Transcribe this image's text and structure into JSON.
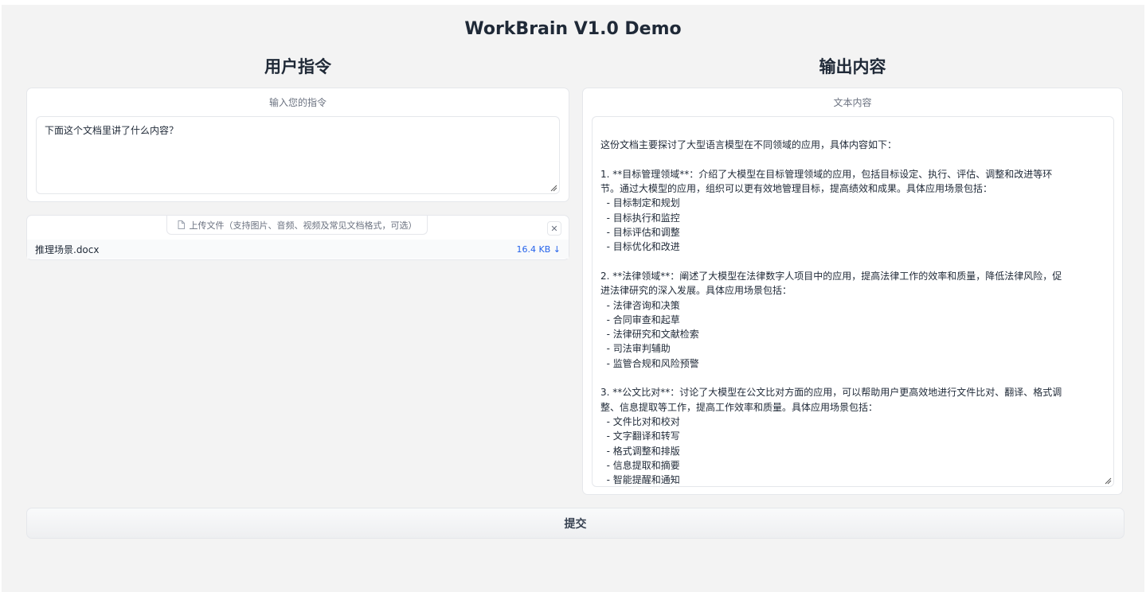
{
  "app_title": "WorkBrain V1.0 Demo",
  "left": {
    "title": "用户指令",
    "instruction_label": "输入您的指令",
    "instruction_value": "下面这个文档里讲了什么内容？",
    "upload_label": "上传文件（支持图片、音频、视频及常见文档格式，可选）",
    "clear_icon": "close-icon",
    "file": {
      "name": "推理场景.docx",
      "size": "16.4 KB ↓"
    }
  },
  "right": {
    "title": "输出内容",
    "output_label": "文本内容",
    "output_lines": [
      "",
      "这份文档主要探讨了大型语言模型在不同领域的应用，具体内容如下：",
      "",
      "1. **目标管理领域**：介绍了大模型在目标管理领域的应用，包括目标设定、执行、评估、调整和改进等环",
      "节。通过大模型的应用，组织可以更有效地管理目标，提高绩效和成果。具体应用场景包括：",
      "  - 目标制定和规划",
      "  - 目标执行和监控",
      "  - 目标评估和调整",
      "  - 目标优化和改进",
      "",
      "2. **法律领域**：阐述了大模型在法律数字人项目中的应用，提高法律工作的效率和质量，降低法律风险，促",
      "进法律研究的深入发展。具体应用场景包括：",
      "  - 法律咨询和决策",
      "  - 合同审查和起草",
      "  - 法律研究和文献检索",
      "  - 司法审判辅助",
      "  - 监管合规和风险预警",
      "",
      "3. **公文比对**：讨论了大模型在公文比对方面的应用，可以帮助用户更高效地进行文件比对、翻译、格式调",
      "整、信息提取等工作，提高工作效率和质量。具体应用场景包括：",
      "  - 文件比对和校对",
      "  - 文字翻译和转写",
      "  - 格式调整和排版",
      "  - 信息提取和摘要",
      "  - 智能提醒和通知"
    ]
  },
  "submit_label": "提交"
}
